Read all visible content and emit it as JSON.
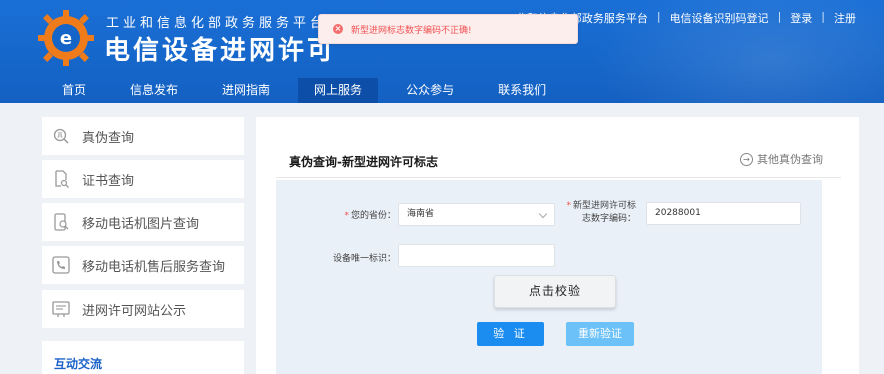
{
  "header": {
    "subtitle": "工业和信息化部政务服务平台",
    "title": "电信设备进网许可",
    "top_links": [
      "工业和信息化部政务服务平台",
      "电信设备识别码登记",
      "登录",
      "注册"
    ]
  },
  "nav": {
    "items": [
      "首页",
      "信息发布",
      "进网指南",
      "网上服务",
      "公众参与",
      "联系我们"
    ],
    "active": "网上服务"
  },
  "toast": {
    "message": "新型进网标志数字编码不正确!",
    "icon": "error-icon"
  },
  "sidebar": {
    "items": [
      {
        "label": "真伪查询",
        "icon": "search-certificate-icon"
      },
      {
        "label": "证书查询",
        "icon": "document-search-icon"
      },
      {
        "label": "移动电话机图片查询",
        "icon": "phone-image-icon"
      },
      {
        "label": "移动电话机售后服务查询",
        "icon": "phone-service-icon"
      },
      {
        "label": "进网许可网站公示",
        "icon": "announcement-icon"
      }
    ],
    "section_title": "互动交流"
  },
  "panel": {
    "title": "真伪查询-新型进网许可标志",
    "other_link": "其他真伪查询"
  },
  "form": {
    "province_label": "您的省份：",
    "province_value": "海南省",
    "code_label_line1": "新型进网许可标",
    "code_label_line2": "志数字编码：",
    "code_value": "20288001",
    "device_id_label": "设备唯一标识：",
    "device_id_value": "",
    "captcha_text": "点击校验",
    "verify_label": "验 证",
    "reset_label": "重新验证"
  },
  "colors": {
    "header_blue": "#1565c8",
    "nav_active": "#0d4fa8",
    "primary_button": "#1b8cf0",
    "secondary_button": "#6cc1f8",
    "error": "#f05050"
  }
}
